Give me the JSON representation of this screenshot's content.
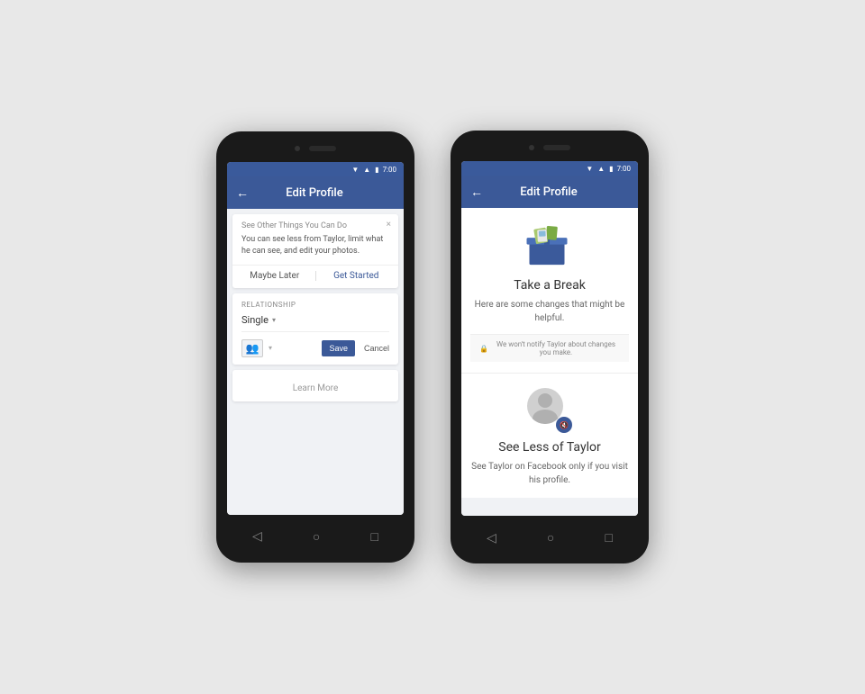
{
  "phone_left": {
    "status": {
      "time": "7:00"
    },
    "app_bar": {
      "back_label": "←",
      "title": "Edit Profile"
    },
    "notification": {
      "title": "See Other Things You Can Do",
      "body": "You can see less from Taylor, limit what he can see, and edit your photos.",
      "close": "×",
      "maybe_later": "Maybe Later",
      "get_started": "Get Started"
    },
    "relationship": {
      "label": "RELATIONSHIP",
      "value": "Single",
      "save": "Save",
      "cancel": "Cancel",
      "learn_more": "Learn More"
    }
  },
  "phone_right": {
    "status": {
      "time": "7:00"
    },
    "app_bar": {
      "back_label": "←",
      "title": "Edit Profile"
    },
    "break_section": {
      "title": "Take a Break",
      "description": "Here are some changes that might be helpful.",
      "privacy_note": "We won't notify Taylor about changes you make."
    },
    "see_less_section": {
      "title": "See Less of Taylor",
      "description": "See Taylor on Facebook only if you visit his profile."
    }
  },
  "nav": {
    "back": "◁",
    "home": "○",
    "recent": "□"
  }
}
